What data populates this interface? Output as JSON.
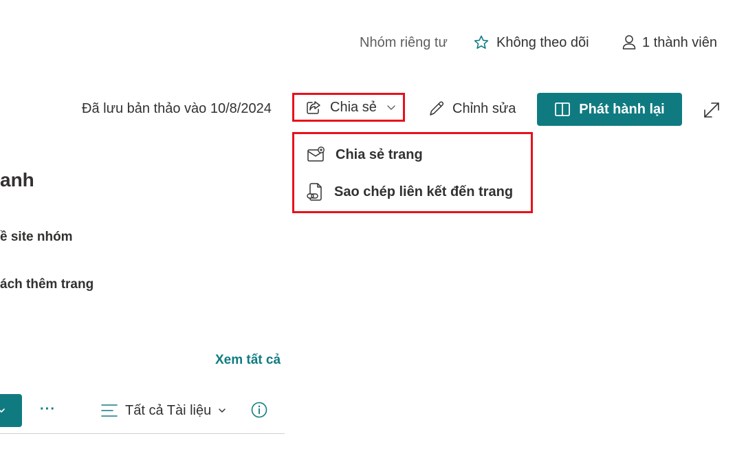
{
  "header": {
    "privacy_label": "Nhóm riêng tư",
    "follow_label": "Không theo dõi",
    "members_label": "1 thành viên"
  },
  "commandbar": {
    "draft_status": "Đã lưu bản thảo vào 10/8/2024",
    "share_label": "Chia sẻ",
    "edit_label": "Chỉnh sửa",
    "publish_label": "Phát hành lại"
  },
  "share_menu": {
    "items": [
      {
        "label": "Chia sẻ trang",
        "icon": "mail-share-icon"
      },
      {
        "label": "Sao chép liên kết đến trang",
        "icon": "document-link-icon"
      }
    ]
  },
  "content": {
    "title_partial": "anh",
    "line1_partial": "ề site nhóm",
    "line2_partial": "ách thêm trang",
    "see_all_label": "Xem tất cả",
    "more_label": "···",
    "view_label": "Tất cả Tài liệu"
  },
  "colors": {
    "accent": "#0f7b81",
    "highlight_border": "#e8101b",
    "text": "#323130",
    "muted_text": "#605e5c"
  }
}
